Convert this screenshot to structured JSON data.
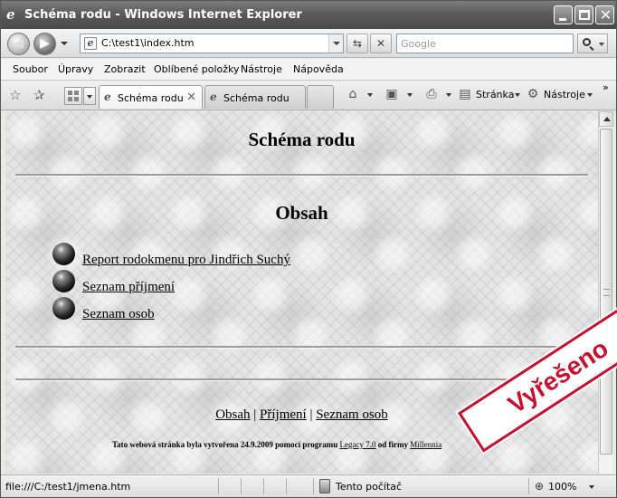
{
  "window": {
    "title": "Schéma rodu - Windows Internet Explorer"
  },
  "address": {
    "url": "C:\\test1\\index.htm"
  },
  "search": {
    "placeholder": "Google"
  },
  "menu": [
    "Soubor",
    "Úpravy",
    "Zobrazit",
    "Oblíbené položky",
    "Nástroje",
    "Nápověda"
  ],
  "tabs": [
    {
      "label": "Schéma rodu",
      "active": true
    },
    {
      "label": "Schéma rodu",
      "active": false
    }
  ],
  "commands": {
    "page": "Stránka",
    "tools": "Nástroje"
  },
  "page": {
    "title": "Schéma rodu",
    "contents_heading": "Obsah",
    "links": [
      "Report rodokmenu pro Jindřich Suchý",
      "Seznam příjmení",
      "Seznam osob"
    ],
    "footer_links": [
      "Obsah",
      "Příjmení",
      "Seznam osob"
    ],
    "footer_separator": " | ",
    "credit": {
      "prefix": "Tato webová stránka byla vytvořena 24.9.2009 pomocí programu ",
      "program": "Legacy 7.0",
      "middle": " od firmy ",
      "company": "Millennia"
    }
  },
  "status": {
    "url": "file:///C:/test1/jmena.htm",
    "zone": "Tento počítač",
    "zoom": "100%"
  },
  "stamp": {
    "text": "Vyřešeno",
    "color": "#c8102e"
  }
}
